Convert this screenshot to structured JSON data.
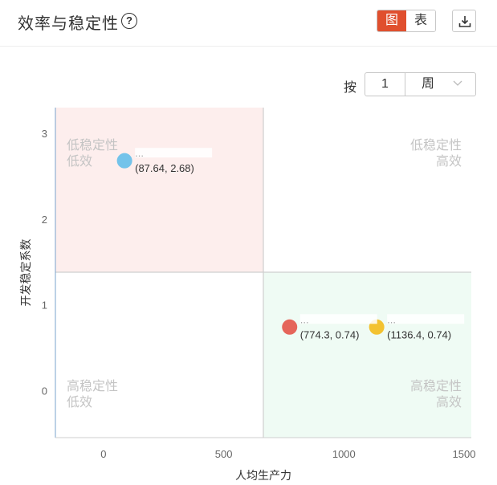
{
  "header": {
    "title": "效率与稳定性",
    "help_icon": "question-circle-icon",
    "view_chart_label": "图",
    "view_table_label": "表",
    "download_icon": "download-icon",
    "accent_color": "#e04f2e"
  },
  "period": {
    "label": "按",
    "count": "1",
    "unit": "周"
  },
  "chart_data": {
    "type": "scatter",
    "xlabel": "人均生产力",
    "ylabel": "开发稳定系数",
    "xlim": [
      -200,
      1530
    ],
    "ylim": [
      -0.55,
      3.3
    ],
    "xticks": [
      0,
      500,
      1000,
      1500
    ],
    "yticks": [
      0,
      1,
      2,
      3
    ],
    "divider_x": 665,
    "divider_y": 1.38,
    "quadrants": [
      {
        "position": "top-left",
        "line1": "低稳定性",
        "line2": "低效",
        "fill": "#fdeeed"
      },
      {
        "position": "top-right",
        "line1": "低稳定性",
        "line2": "高效",
        "fill": "#ffffff"
      },
      {
        "position": "bottom-left",
        "line1": "高稳定性",
        "line2": "低效",
        "fill": "#ffffff"
      },
      {
        "position": "bottom-right",
        "line1": "高稳定性",
        "line2": "高效",
        "fill": "#effbf4"
      }
    ],
    "points": [
      {
        "name": "...",
        "x": 87.64,
        "y": 2.68,
        "label": "(87.64, 2.68)",
        "color": "#73c3ea"
      },
      {
        "name": "...",
        "x": 774.3,
        "y": 0.74,
        "label": "(774.3, 0.74)",
        "color": "#e5655a"
      },
      {
        "name": "...",
        "x": 1136.4,
        "y": 0.74,
        "label": "(1136.4, 0.74)",
        "color": "#f3c230"
      }
    ],
    "grid": false,
    "legend": "none"
  }
}
